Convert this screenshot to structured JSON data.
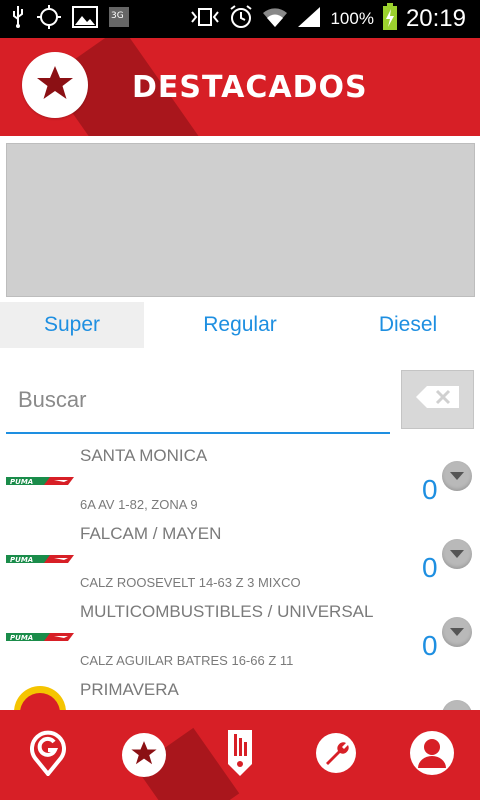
{
  "status_bar": {
    "battery_text": "100%",
    "time": "20:19",
    "network_label": "3G"
  },
  "header": {
    "title": "DESTACADOS",
    "icon": "star-icon"
  },
  "tabs": [
    {
      "label": "Super",
      "selected": true
    },
    {
      "label": "Regular",
      "selected": false
    },
    {
      "label": "Diesel",
      "selected": false
    }
  ],
  "search": {
    "placeholder": "Buscar",
    "value": ""
  },
  "stations": [
    {
      "name": "SANTA MONICA",
      "address": "6A AV 1-82, ZONA 9",
      "price": "0",
      "brand": "PUMA"
    },
    {
      "name": "FALCAM / MAYEN",
      "address": "CALZ ROOSEVELT 14-63 Z 3 MIXCO",
      "price": "0",
      "brand": "PUMA"
    },
    {
      "name": "MULTICOMBUSTIBLES / UNIVERSAL",
      "address": "CALZ AGUILAR BATRES 16-66 Z 11",
      "price": "0",
      "brand": "PUMA"
    },
    {
      "name": "PRIMAVERA",
      "address": "",
      "price": "",
      "brand": "Shell"
    }
  ],
  "bottom_nav": [
    {
      "icon": "map-pin-g-icon"
    },
    {
      "icon": "star-icon",
      "selected": true
    },
    {
      "icon": "fuel-gauge-icon"
    },
    {
      "icon": "wrench-icon"
    },
    {
      "icon": "user-icon"
    }
  ],
  "colors": {
    "brand_red": "#d71f26",
    "brand_red_dark": "#a9161c",
    "accent_blue": "#1e8fe1",
    "text_gray": "#7a7a7a"
  }
}
